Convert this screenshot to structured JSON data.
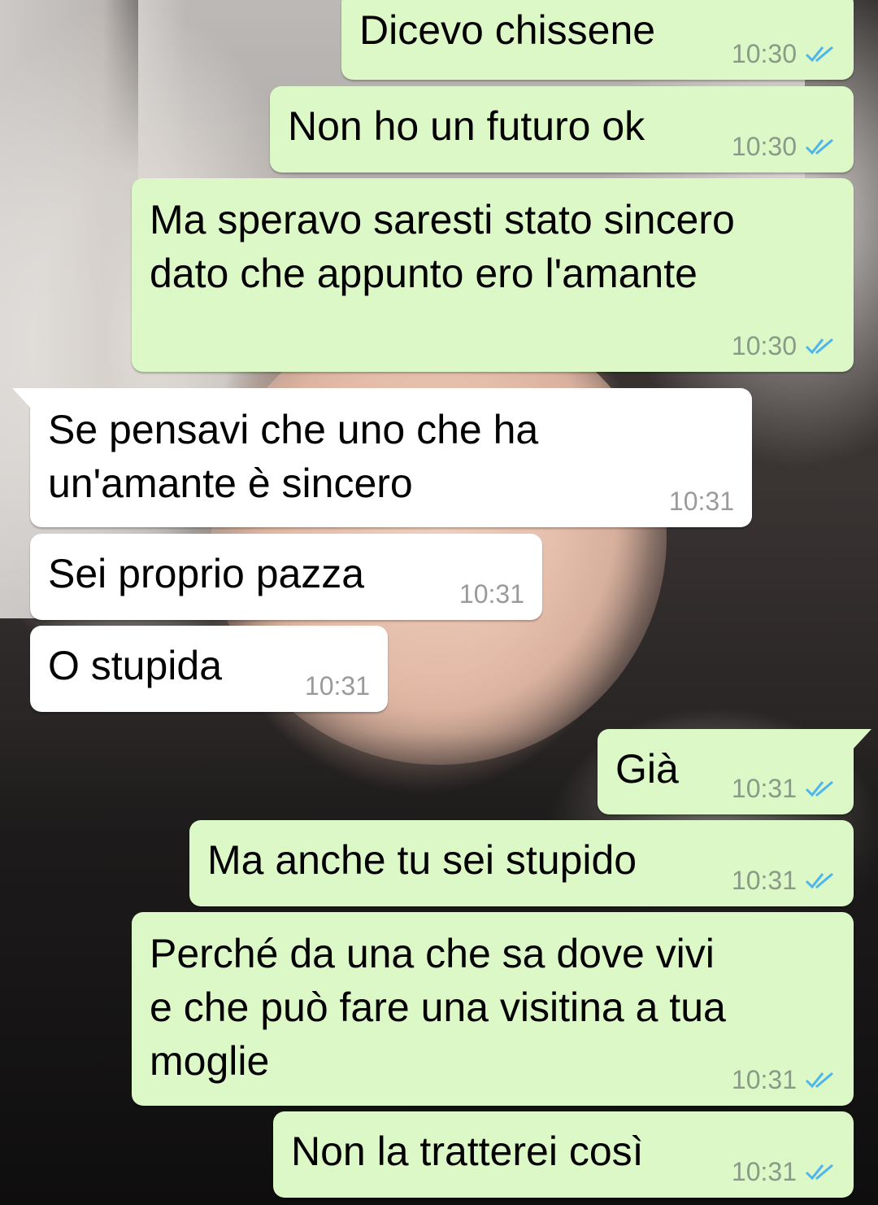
{
  "messages": [
    {
      "id": "m1",
      "direction": "outgoing",
      "text": "Dicevo chissene",
      "time": "10:30",
      "status": "read"
    },
    {
      "id": "m2",
      "direction": "outgoing",
      "text": "Non ho un futuro ok",
      "time": "10:30",
      "status": "read"
    },
    {
      "id": "m3",
      "direction": "outgoing",
      "text": "Ma speravo saresti stato sincero\ndato che appunto ero l'amante",
      "time": "10:30",
      "status": "read"
    },
    {
      "id": "m4",
      "direction": "incoming",
      "text": "Se pensavi che uno che ha\nun'amante è sincero",
      "time": "10:31"
    },
    {
      "id": "m5",
      "direction": "incoming",
      "text": "Sei proprio pazza",
      "time": "10:31"
    },
    {
      "id": "m6",
      "direction": "incoming",
      "text": "O stupida",
      "time": "10:31"
    },
    {
      "id": "m7",
      "direction": "outgoing",
      "text": "Già",
      "time": "10:31",
      "status": "read"
    },
    {
      "id": "m8",
      "direction": "outgoing",
      "text": "Ma anche tu sei stupido",
      "time": "10:31",
      "status": "read"
    },
    {
      "id": "m9",
      "direction": "outgoing",
      "text": "Perché da una che sa dove vivi\ne che può fare una visitina a tua\nmoglie",
      "time": "10:31",
      "status": "read"
    },
    {
      "id": "m10",
      "direction": "outgoing",
      "text": "Non la tratterei così",
      "time": "10:31",
      "status": "read"
    }
  ],
  "colors": {
    "outgoing_bubble": "#dcf8c6",
    "incoming_bubble": "#ffffff",
    "read_ticks": "#4fb6ec",
    "timestamp_out": "#8a9a88",
    "timestamp_in": "#9a9a9a"
  },
  "icons": {
    "read_status": "double-check-icon"
  },
  "wallpaper": {
    "type": "photo"
  }
}
